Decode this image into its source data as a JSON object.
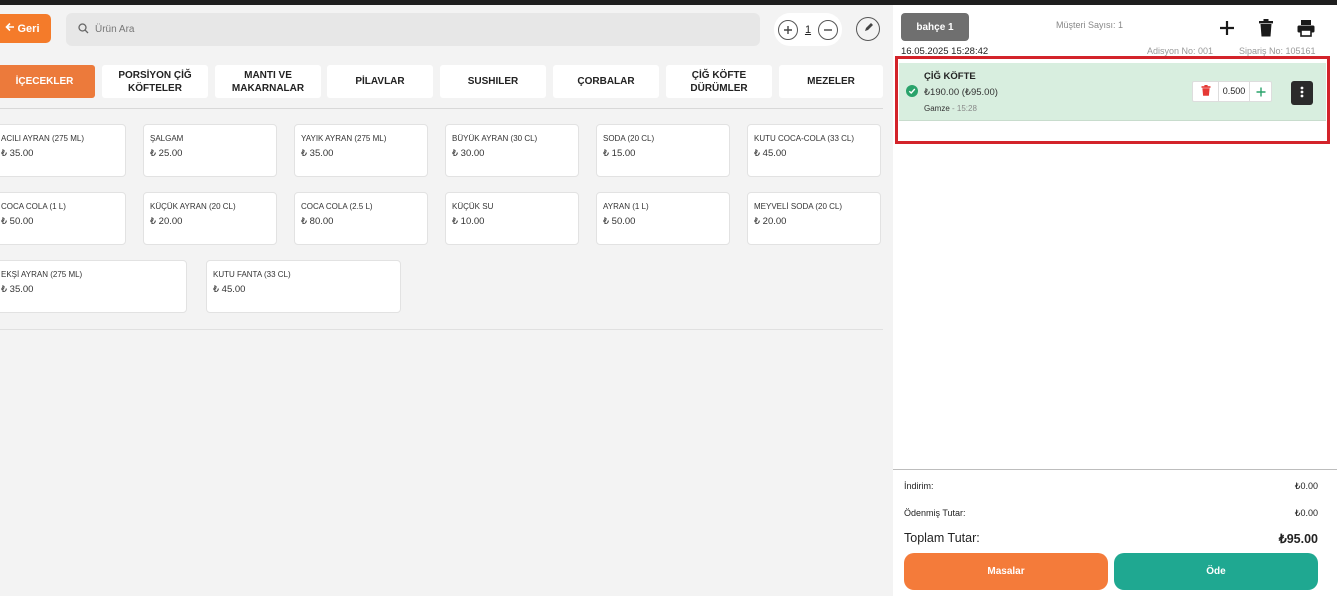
{
  "header": {
    "back_label": "Geri",
    "search_placeholder": "Ürün Ara",
    "guest_count_value": "1"
  },
  "categories": [
    {
      "label": "İÇECEKLER",
      "active": true
    },
    {
      "label": "PORSİYON ÇİĞ KÖFTELER",
      "active": false
    },
    {
      "label": "MANTI VE MAKARNALAR",
      "active": false
    },
    {
      "label": "PİLAVLAR",
      "active": false
    },
    {
      "label": "SUSHILER",
      "active": false
    },
    {
      "label": "ÇORBALAR",
      "active": false
    },
    {
      "label": "ÇİĞ KÖFTE DÜRÜMLER",
      "active": false
    },
    {
      "label": "MEZELER",
      "active": false
    }
  ],
  "products": [
    {
      "name": "ACILI AYRAN (275 ML)",
      "price": "₺ 35.00"
    },
    {
      "name": "ŞALGAM",
      "price": "₺ 25.00"
    },
    {
      "name": "YAYIK AYRAN (275 ML)",
      "price": "₺ 35.00"
    },
    {
      "name": "BÜYÜK AYRAN (30 CL)",
      "price": "₺ 30.00"
    },
    {
      "name": "SODA (20 CL)",
      "price": "₺ 15.00"
    },
    {
      "name": "KUTU COCA-COLA (33 CL)",
      "price": "₺ 45.00"
    },
    {
      "name": "COCA COLA (1 L)",
      "price": "₺ 50.00"
    },
    {
      "name": "KÜÇÜK AYRAN (20 CL)",
      "price": "₺ 20.00"
    },
    {
      "name": "COCA COLA (2.5 L)",
      "price": "₺ 80.00"
    },
    {
      "name": "KÜÇÜK SU",
      "price": "₺ 10.00"
    },
    {
      "name": "AYRAN (1 L)",
      "price": "₺ 50.00"
    },
    {
      "name": "MEYVELİ SODA (20 CL)",
      "price": "₺ 20.00"
    },
    {
      "name": "EKŞİ AYRAN (275 ML)",
      "price": "₺ 35.00"
    },
    {
      "name": "KUTU FANTA (33 CL)",
      "price": "₺ 45.00"
    }
  ],
  "order": {
    "table_label": "bahçe 1",
    "customer_count_label": "Müşteri Sayısı: 1",
    "datetime": "16.05.2025 15:28:42",
    "adisyon_no": "Adisyon No: 001",
    "siparis_no": "Sipariş No: 105161",
    "items": [
      {
        "name": "ÇİĞ KÖFTE",
        "price": "₺190.00 (₺95.00)",
        "waiter": "Gamze",
        "time": "15:28",
        "quantity": "0.500"
      }
    ]
  },
  "summary": {
    "discount_label": "İndirim:",
    "discount_value": "₺0.00",
    "paid_label": "Ödenmiş Tutar:",
    "paid_value": "₺0.00",
    "total_label": "Toplam Tutar:",
    "total_value": "₺95.00"
  },
  "actions": {
    "tables_label": "Masalar",
    "pay_label": "Öde"
  },
  "colors": {
    "accent_orange": "#f47b2a",
    "pay_teal": "#1fa891",
    "highlight_red": "#d3232a",
    "order_item_green": "#d8eedf"
  }
}
